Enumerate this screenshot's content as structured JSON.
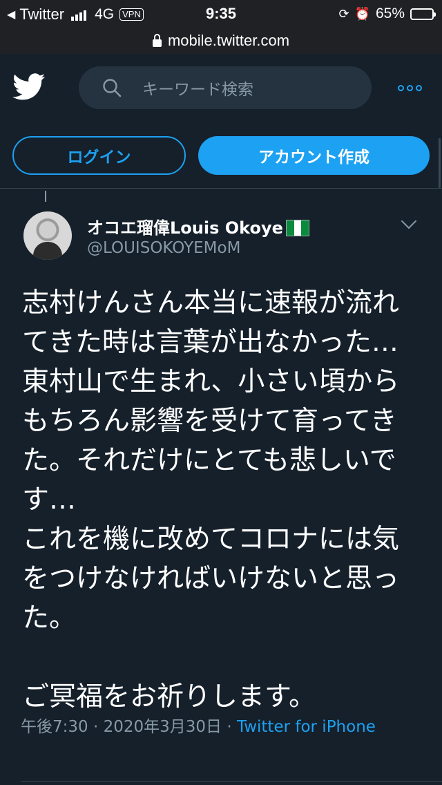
{
  "status_bar": {
    "back_app": "Twitter",
    "network": "4G",
    "vpn": "VPN",
    "time": "9:35",
    "battery": "65%",
    "battery_level": 0.65
  },
  "browser": {
    "url": "mobile.twitter.com"
  },
  "header": {
    "search_placeholder": "キーワード検索"
  },
  "auth": {
    "login_label": "ログイン",
    "signup_label": "アカウント作成"
  },
  "tweet": {
    "display_name": "オコエ瑠偉Louis Okoye",
    "handle": "@LOUISOKOYEMoM",
    "text": "志村けんさん本当に速報が流れてきた時は言葉が出なかった…東村山で生まれ、小さい頃からもちろん影響を受けて育ってきた。それだけにとても悲しいです…\nこれを機に改めてコロナには気をつけなければいけないと思った。\n\nご冥福をお祈りします。",
    "time": "午後7:30",
    "date": "2020年3月30日",
    "separator": "·",
    "source": "Twitter for iPhone"
  },
  "colors": {
    "background": "#15202b",
    "accent": "#1da1f2",
    "secondary_text": "#8899a6",
    "search_bg": "#253341"
  }
}
